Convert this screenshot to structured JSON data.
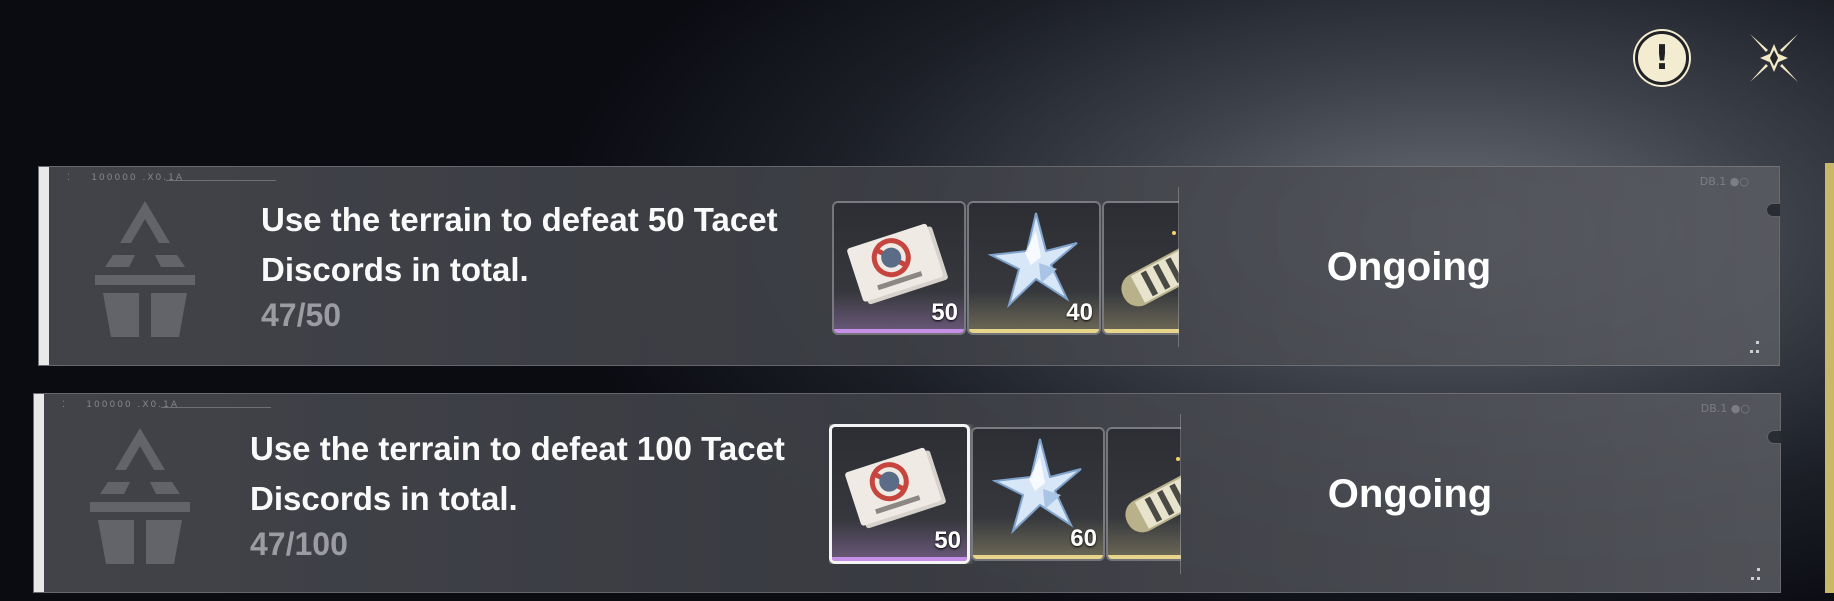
{
  "header": {
    "alert_icon": "exclamation-circle-icon",
    "close_icon": "close-x-icon",
    "alert_glyph": "!"
  },
  "colors": {
    "accent_gold": "#c8b968",
    "rarity_purple": "#c68fe8",
    "rarity_gold": "#e6d58a",
    "card_accent": "#e9e9ea"
  },
  "quests": [
    {
      "title": "Use the terrain to defeat 50 Tacet Discords in total.",
      "progress": "47/50",
      "status": "Ongoing",
      "rewards": [
        {
          "icon": "voucher-icon",
          "quantity": "50",
          "rarity": "purple"
        },
        {
          "icon": "crystal-star-icon",
          "quantity": "40",
          "rarity": "gold"
        },
        {
          "icon": "capsule-icon",
          "quantity": "",
          "rarity": "gold"
        }
      ]
    },
    {
      "title": "Use the terrain to defeat 100 Tacet Discords in total.",
      "progress": "47/100",
      "status": "Ongoing",
      "rewards": [
        {
          "icon": "voucher-icon",
          "quantity": "50",
          "rarity": "purple"
        },
        {
          "icon": "crystal-star-icon",
          "quantity": "60",
          "rarity": "gold"
        },
        {
          "icon": "capsule-icon",
          "quantity": "",
          "rarity": "gold"
        }
      ]
    }
  ]
}
